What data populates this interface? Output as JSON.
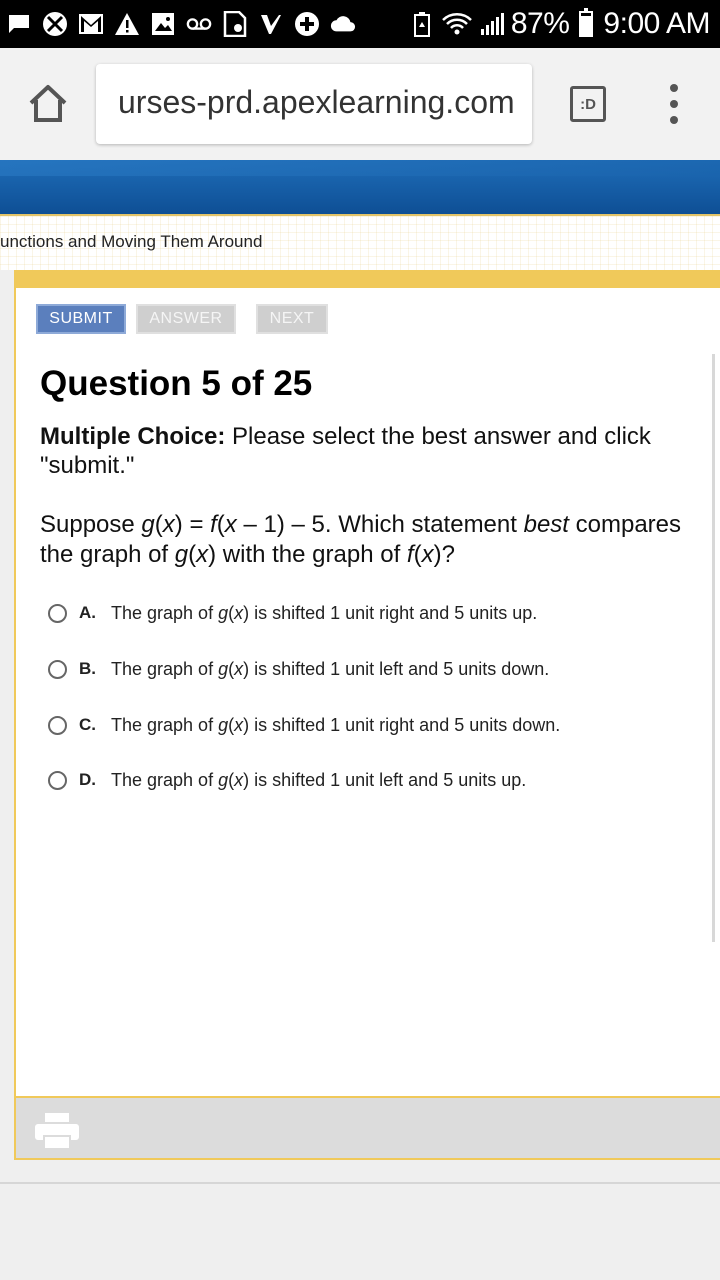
{
  "status_bar": {
    "battery_pct": "87%",
    "battery_level": 0.87,
    "time": "9:00 AM",
    "icons_left": [
      "chat-icon",
      "xbox-icon",
      "gmail-icon",
      "warning-icon",
      "image-icon",
      "voicemail-icon",
      "sim-icon",
      "check-icon",
      "plus-app-icon",
      "cloud-icon"
    ],
    "icons_right": [
      "battery-saver-icon",
      "wifi-icon",
      "signal-icon",
      "battery-icon"
    ]
  },
  "browser": {
    "url": "urses-prd.apexlearning.com",
    "tabs_label": ":D"
  },
  "lesson": {
    "title": "unctions and Moving Them Around"
  },
  "toolbar": {
    "submit_label": "SUBMIT",
    "answer_label": "ANSWER",
    "next_label": "NEXT"
  },
  "question": {
    "title": "Question 5 of 25",
    "instructions_bold": "Multiple Choice:",
    "instructions_rest": " Please select the best answer and click \"submit.\"",
    "prompt": {
      "p1": "Suppose ",
      "g": "g",
      "p2": "(",
      "x1": "x",
      "p3": ") = ",
      "f1": "f",
      "p4": "(",
      "x2": "x",
      "p5": " – 1) – 5. Which statement ",
      "best": "best",
      "p6": " compares the graph of ",
      "g2": "g",
      "p7": "(",
      "x3": "x",
      "p8": ") with the graph of ",
      "f2": "f",
      "p9": "(",
      "x4": "x",
      "p10": ")?"
    },
    "choices": [
      {
        "letter": "A.",
        "pre": "The graph of ",
        "g": "g",
        "open": "(",
        "x": "x",
        "post": ") is shifted 1 unit right and 5 units up."
      },
      {
        "letter": "B.",
        "pre": "The graph of ",
        "g": "g",
        "open": "(",
        "x": "x",
        "post": ") is shifted 1 unit left and 5 units down."
      },
      {
        "letter": "C.",
        "pre": "The graph of ",
        "g": "g",
        "open": "(",
        "x": "x",
        "post": ") is shifted 1 unit right and 5 units down."
      },
      {
        "letter": "D.",
        "pre": "The graph of ",
        "g": "g",
        "open": "(",
        "x": "x",
        "post": ") is shifted 1 unit left and 5 units up."
      }
    ]
  },
  "colors": {
    "banner": "#1565b0",
    "accent_gold": "#f0c95a",
    "submit_bg": "#5b7fbd"
  }
}
